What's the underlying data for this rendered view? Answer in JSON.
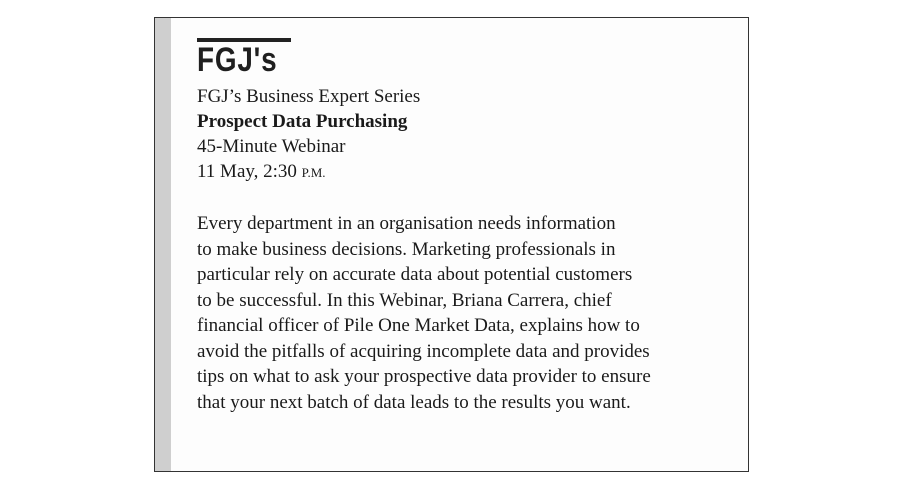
{
  "notice": {
    "logo_text": "FGJ's",
    "series": "FGJ’s Business Expert Series",
    "title": "Prospect Data Purchasing",
    "format": "45-Minute Webinar",
    "date_time": "11 May, 2:30 ",
    "time_suffix": "P.M.",
    "description_lines": [
      "Every department in an organisation needs information",
      "to make business decisions. Marketing professionals in",
      "particular rely on accurate data about potential customers",
      "to be successful. In this Webinar, Briana Carrera, chief",
      "financial officer of Pile One Market Data, explains how to",
      "avoid the pitfalls of acquiring incomplete data and provides",
      "tips on what to ask your prospective data provider to ensure",
      "that your next batch of data leads to the results you want."
    ]
  }
}
